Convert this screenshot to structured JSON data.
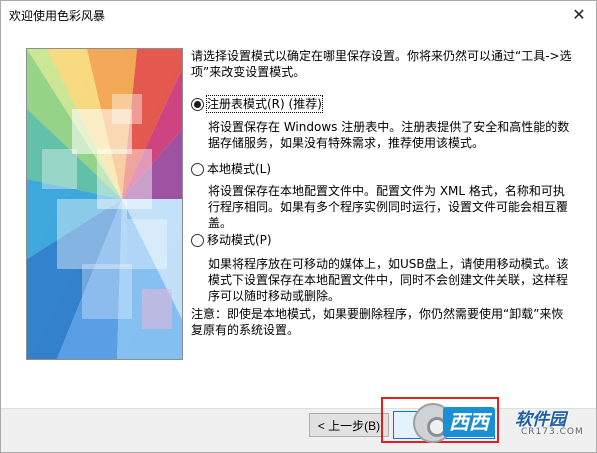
{
  "window": {
    "title": "欢迎使用色彩风暴",
    "close_glyph": "✕"
  },
  "intro": "请选择设置模式以确定在哪里保存设置。你将来仍然可以通过“工具->选项”来改变设置模式。",
  "options": [
    {
      "label": "注册表模式(R) (推荐)",
      "checked": true,
      "description": "将设置保存在 Windows 注册表中。注册表提供了安全和高性能的数据存储服务，如果没有特殊需求，推荐使用该模式。"
    },
    {
      "label": "本地模式(L)",
      "checked": false,
      "description": "将设置保存在本地配置文件中。配置文件为 XML 格式，名称和可执行程序相同。如果有多个程序实例同时运行，设置文件可能会相互覆盖。"
    },
    {
      "label": "移动模式(P)",
      "checked": false,
      "description": "如果将程序放在可移动的媒体上，如USB盘上，请使用移动模式。该模式下设置保存在本地配置文件中，同时不会创建文件关联，这样程序可以随时移动或删除。"
    }
  ],
  "note": "注意：即使是本地模式，如果要删除程序，你仍然需要使用“卸载”来恢复原有的系统设置。",
  "buttons": {
    "back": "< 上一步(B)",
    "next": ""
  },
  "watermark": {
    "brand": "西西",
    "site": "软件园",
    "url": "CR173.COM"
  },
  "colors": {
    "highlight_box": "#e02020",
    "watermark_blue": "#1b8fd6"
  },
  "icons": {
    "close": "close-icon",
    "art": "color-burst-art"
  }
}
